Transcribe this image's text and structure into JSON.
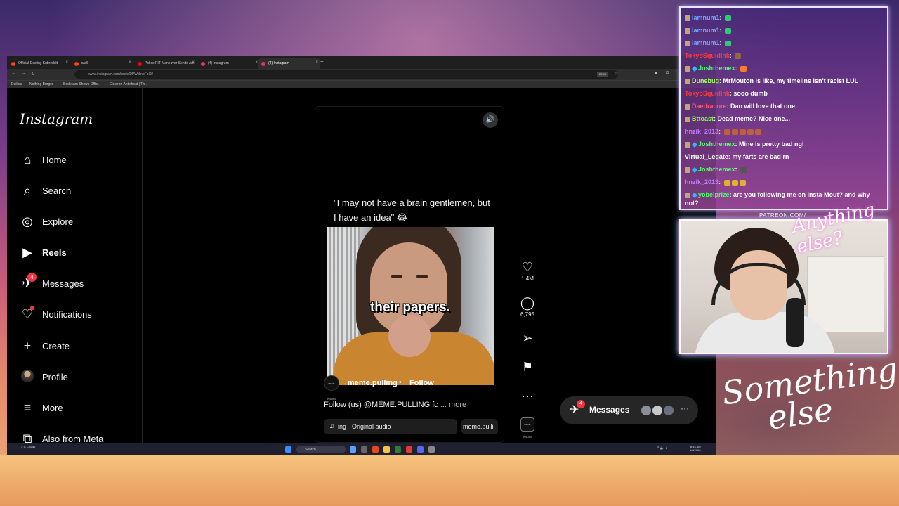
{
  "browser": {
    "tabs": [
      {
        "label": "Official Destiny Subreddit",
        "color": "#ff4500",
        "active": false
      },
      {
        "label": "s/all",
        "color": "#ff4500",
        "active": false
      },
      {
        "label": "Police PIT Maneuver Sends Am",
        "color": "#ff0000",
        "active": false
      },
      {
        "label": "(4) Instagram",
        "color": "#e1306c",
        "active": false
      },
      {
        "label": "(4) Instagram",
        "color": "#e1306c",
        "active": true
      }
    ],
    "new_tab": "+",
    "url": "www.instagram.com/reels/DPWdtnpFpCt/",
    "zoom": "200%",
    "bookmarks": [
      "Dailies",
      "Nothing Burger",
      "Bodycam Shows Offic...",
      "Electron Anticheat | Th..."
    ]
  },
  "instagram": {
    "logo": "Instagram",
    "nav": [
      {
        "label": "Home",
        "icon": "⌂"
      },
      {
        "label": "Search",
        "icon": "⌕"
      },
      {
        "label": "Explore",
        "icon": "◎"
      },
      {
        "label": "Reels",
        "icon": "▶"
      },
      {
        "label": "Messages",
        "icon": "✈",
        "badge": "4"
      },
      {
        "label": "Notifications",
        "icon": "♡"
      },
      {
        "label": "Create",
        "icon": "+"
      },
      {
        "label": "Profile",
        "icon": ""
      },
      {
        "label": "More",
        "icon": "≡"
      },
      {
        "label": "Also from Meta",
        "icon": "⧉"
      }
    ],
    "reel": {
      "caption": "\"I may not have a brain gentlemen, but I have an idea\" 😂",
      "subtitle": "their papers.",
      "account": "meme.pulling",
      "avatar_text": "MEME PULLING",
      "separator": "•",
      "follow": "Follow",
      "description": "Follow (us) @MEME.PULLING fc",
      "more": "... more",
      "audio_icon": "♫",
      "audio": "ing · Original audio",
      "audio_right": "meme.pulli"
    },
    "actions": {
      "like_icon": "♡",
      "likes": "1.4M",
      "comment_icon": "◯",
      "comments": "6,795",
      "share_icon": "➢",
      "save_icon": "⚑",
      "more_icon": "···",
      "audio_thumb": "MEME PULLING"
    },
    "messages_pill": {
      "label": "Messages",
      "badge": "4",
      "icon": "✈",
      "more": "···"
    },
    "sound_icon": "🔊"
  },
  "taskbar": {
    "weather": "3°C Cloudy",
    "search": "Search",
    "time": "8:44 AM",
    "date": "1/8/2026"
  },
  "chat": [
    {
      "user": "iamnum1",
      "color": "#6fa8ff",
      "text": "",
      "emote": true
    },
    {
      "user": "iamnum1",
      "color": "#6fa8ff",
      "text": "",
      "emote": true
    },
    {
      "user": "iamnum1",
      "color": "#6fa8ff",
      "text": "",
      "emote": true
    },
    {
      "user": "TokyoSquidInk",
      "color": "#ff3b3b",
      "text": "",
      "emote": true
    },
    {
      "user": "Joshthemex",
      "color": "#4dff6a",
      "text": "",
      "emote": true
    },
    {
      "user": "Dunebug",
      "color": "#9fff5a",
      "text": "MrMouton is like, my timeline isn't racist LUL"
    },
    {
      "user": "TokyoSquidInk",
      "color": "#ff3b3b",
      "text": "sooo dumb"
    },
    {
      "user": "Daedracore",
      "color": "#ff5577",
      "text": "Dan will love that one"
    },
    {
      "user": "Bttoast",
      "color": "#7cff4a",
      "text": "Dead meme? Nice one..."
    },
    {
      "user": "hnzik_2013",
      "color": "#c27dff",
      "text": "",
      "emote": true
    },
    {
      "user": "Joshthemex",
      "color": "#4dff6a",
      "text": "Mine is pretty bad ngl"
    },
    {
      "user": "Virtual_Legate",
      "color": "#ffffff",
      "text": "my farts are bad rn"
    },
    {
      "user": "Joshthemex",
      "color": "#4dff6a",
      "text": "",
      "emote": true
    },
    {
      "user": "hnzik_2013",
      "color": "#c27dff",
      "text": "",
      "emote": true
    },
    {
      "user": "yobelprize",
      "color": "#4dff6a",
      "text": "are you following me on insta Mout? and why not?"
    }
  ],
  "overlay": {
    "patreon": "PATREON.COM/",
    "sig_top": "Anything else?",
    "sig_bottom_1": "Something",
    "sig_bottom_2": "else"
  }
}
